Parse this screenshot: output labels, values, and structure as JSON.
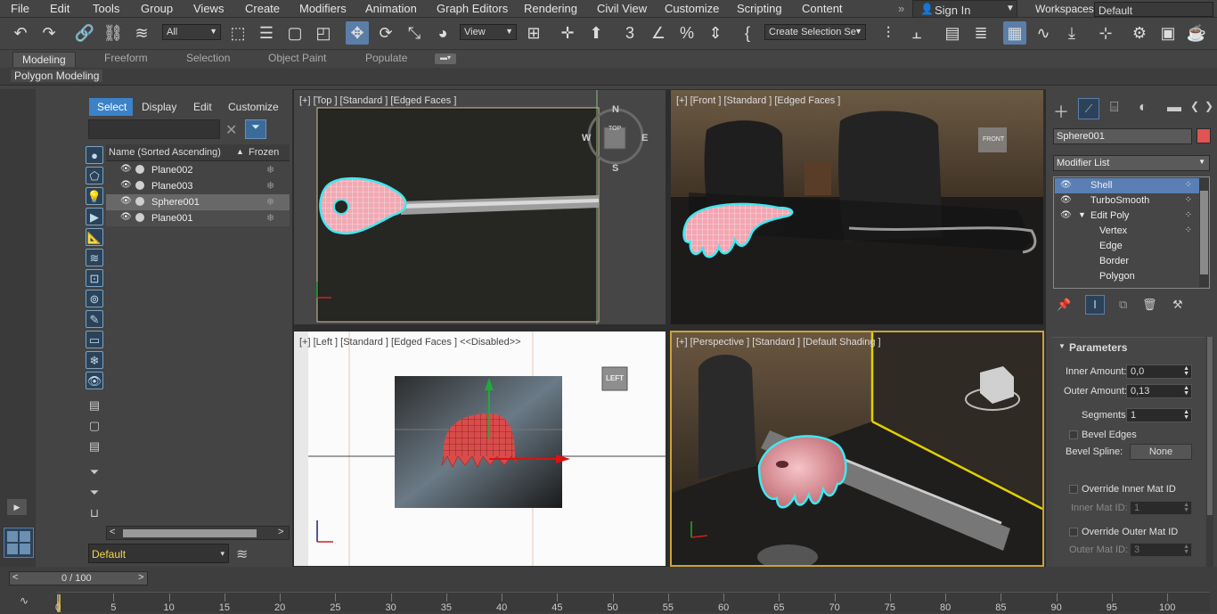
{
  "menu": [
    "File",
    "Edit",
    "Tools",
    "Group",
    "Views",
    "Create",
    "Modifiers",
    "Animation",
    "Graph Editors",
    "Rendering",
    "Civil View",
    "Customize",
    "Scripting",
    "Content"
  ],
  "signin": "Sign In",
  "workspaces_label": "Workspaces:",
  "workspace": "Default",
  "toolbar": {
    "filter": "All",
    "refcoord": "View",
    "selection_set": "Create Selection Se"
  },
  "ribbon": {
    "tabs": [
      "Modeling",
      "Freeform",
      "Selection",
      "Object Paint",
      "Populate"
    ],
    "sub": "Polygon Modeling"
  },
  "scene": {
    "tabs": [
      "Select",
      "Display",
      "Edit",
      "Customize"
    ],
    "col_name": "Name (Sorted Ascending)",
    "col_frozen": "Frozen",
    "rows": [
      "Plane002",
      "Plane003",
      "Sphere001",
      "Plane001"
    ],
    "layer": "Default"
  },
  "viewports": {
    "top": "[+] [Top ] [Standard ] [Edged Faces ]",
    "front": "[+] [Front ] [Standard ] [Edged Faces ]",
    "left": "[+] [Left ] [Standard ] [Edged Faces ]  <<Disabled>>",
    "persp": "[+] [Perspective ] [Standard ] [Default Shading ]",
    "cube_top": "TOP",
    "cube_front": "FRONT",
    "cube_left": "LEFT",
    "compass": {
      "n": "N",
      "s": "S",
      "e": "E",
      "w": "W"
    }
  },
  "command": {
    "object_name": "Sphere001",
    "modifier_list": "Modifier List",
    "stack": [
      "Shell",
      "TurboSmooth",
      "Edit Poly",
      "Vertex",
      "Edge",
      "Border",
      "Polygon"
    ],
    "rollout": "Parameters",
    "inner_label": "Inner Amount:",
    "inner": "0,0",
    "outer_label": "Outer Amount:",
    "outer": "0,13",
    "seg_label": "Segments:",
    "seg": "1",
    "bevel_edges": "Bevel Edges",
    "bevel_spline_label": "Bevel Spline:",
    "bevel_spline": "None",
    "ovr_inner": "Override Inner Mat ID",
    "inner_mat_label": "Inner Mat ID:",
    "inner_mat": "1",
    "ovr_outer": "Override Outer Mat ID",
    "outer_mat_label": "Outer Mat ID:",
    "outer_mat": "3"
  },
  "timeline": {
    "frame": "0 / 100",
    "ticks": [
      "0",
      "5",
      "10",
      "15",
      "20",
      "25",
      "30",
      "35",
      "40",
      "45",
      "50",
      "55",
      "60",
      "65",
      "70",
      "75",
      "80",
      "85",
      "90",
      "95",
      "100"
    ]
  },
  "colors": {
    "accent": "#5b7ea8",
    "select_cyan": "#3fe8f0",
    "shape_pink": "#e8a0a8"
  }
}
